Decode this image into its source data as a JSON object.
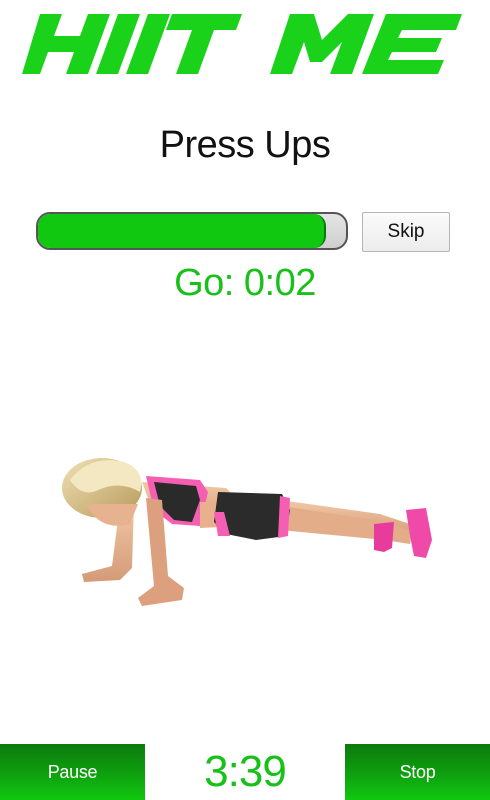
{
  "app": {
    "logo_text": "HIIT ME",
    "brand_color": "#19c019"
  },
  "exercise": {
    "name": "Press Ups",
    "progress_fraction": 0.93,
    "countdown_text": "Go: 0:02",
    "illustration": "woman-doing-press-up"
  },
  "controls": {
    "skip_label": "Skip",
    "pause_label": "Pause",
    "stop_label": "Stop",
    "total_time": "3:39"
  }
}
